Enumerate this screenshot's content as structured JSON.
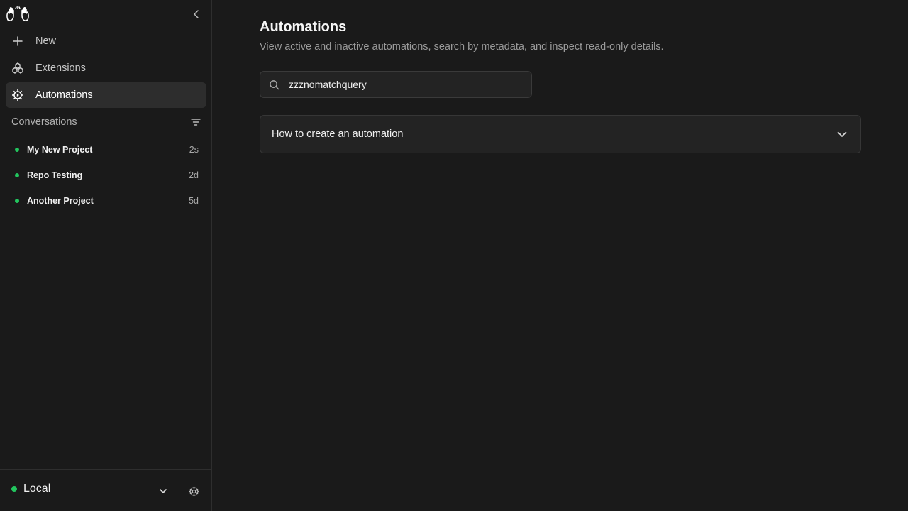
{
  "sidebar": {
    "logo_icon": "waving-hands-logo-icon",
    "collapse_icon": "chevron-left-icon",
    "nav": [
      {
        "label": "New",
        "icon": "plus-icon",
        "active": false
      },
      {
        "label": "Extensions",
        "icon": "extensions-icon",
        "active": false
      },
      {
        "label": "Automations",
        "icon": "automations-gear-icon",
        "active": true
      }
    ],
    "conversations_title": "Conversations",
    "filter_icon": "filter-icon",
    "conversations": [
      {
        "name": "My New Project",
        "age": "2s",
        "status_color": "#22c55e"
      },
      {
        "name": "Repo Testing",
        "age": "2d",
        "status_color": "#22c55e"
      },
      {
        "name": "Another Project",
        "age": "5d",
        "status_color": "#22c55e"
      }
    ],
    "footer": {
      "environment": "Local",
      "environment_status_color": "#22c55e",
      "chevron_icon": "chevron-down-icon",
      "settings_icon": "gear-icon"
    }
  },
  "main": {
    "title": "Automations",
    "description": "View active and inactive automations, search by metadata, and inspect read-only details.",
    "search": {
      "value": "zzznomatchquery",
      "icon": "search-icon"
    },
    "accordion": {
      "label": "How to create an automation",
      "icon": "chevron-down-icon",
      "expanded": false
    }
  },
  "colors": {
    "background": "#1a1a1a",
    "active_item": "#2d2d2d",
    "status_green": "#22c55e"
  }
}
